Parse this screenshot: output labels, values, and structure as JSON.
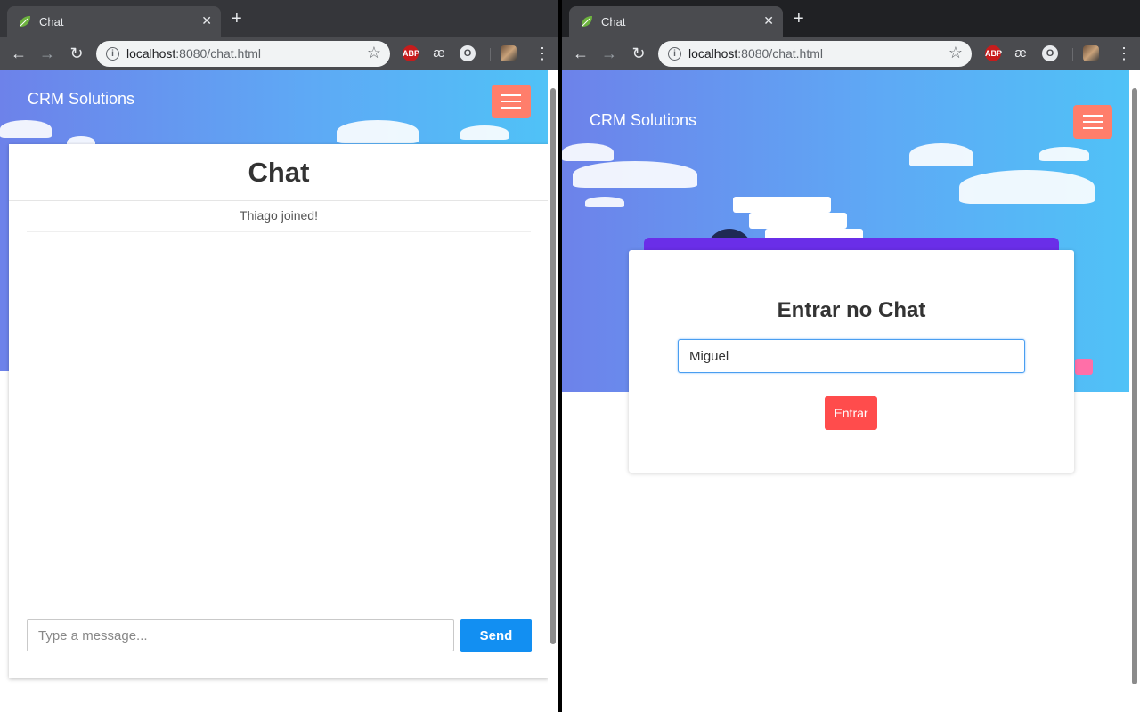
{
  "left": {
    "tab": {
      "title": "Chat",
      "close": "✕"
    },
    "new_tab": "+",
    "url": {
      "host": "localhost",
      "rest": ":8080/chat.html"
    },
    "brand": "CRM Solutions",
    "chat": {
      "title": "Chat",
      "events": [
        "Thiago joined!"
      ],
      "input_placeholder": "Type a message...",
      "send_label": "Send"
    }
  },
  "right": {
    "tab": {
      "title": "Chat",
      "close": "✕"
    },
    "new_tab": "+",
    "url": {
      "host": "localhost",
      "rest": ":8080/chat.html"
    },
    "brand": "CRM Solutions",
    "login": {
      "title": "Entrar no Chat",
      "name_value": "Miguel",
      "enter_label": "Entrar"
    }
  },
  "extensions": {
    "abp": "ABP",
    "ae": "æ",
    "o": "O"
  },
  "colors": {
    "hamburger": "#ff7e6b",
    "send_button": "#128ff2",
    "enter_button": "#ff4c4c",
    "hero_start": "#6d82ea",
    "hero_end": "#4fc3f7"
  }
}
